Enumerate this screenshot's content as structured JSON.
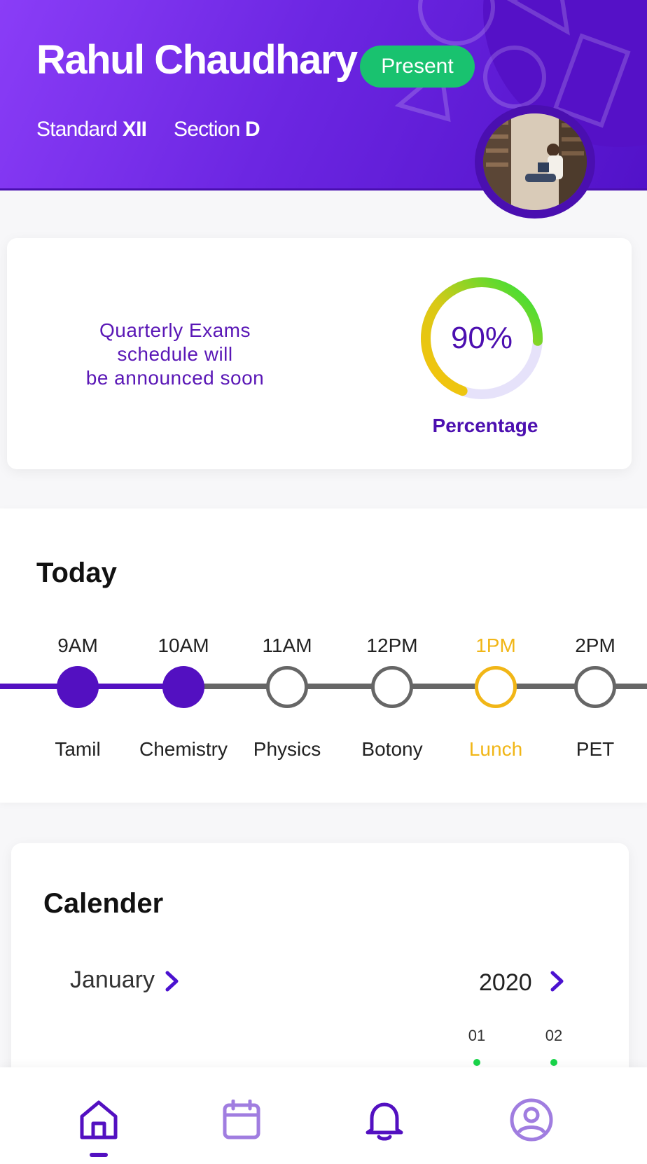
{
  "header": {
    "name": "Rahul Chaudhary",
    "status": "Present",
    "standard_label": "Standard",
    "standard_value": "XII",
    "section_label": "Section",
    "section_value": "D"
  },
  "summary": {
    "notice_line1": "Quarterly Exams",
    "notice_line2": "schedule will",
    "notice_line3": "be announced soon",
    "percentage_value": "90%",
    "percentage_fraction": 0.9,
    "percentage_label": "Percentage"
  },
  "today": {
    "title": "Today",
    "slots": [
      {
        "time": "9AM",
        "subject": "Tamil",
        "state": "done"
      },
      {
        "time": "10AM",
        "subject": "Chemistry",
        "state": "done"
      },
      {
        "time": "11AM",
        "subject": "Physics",
        "state": "todo"
      },
      {
        "time": "12PM",
        "subject": "Botony",
        "state": "todo"
      },
      {
        "time": "1PM",
        "subject": "Lunch",
        "state": "highlight"
      },
      {
        "time": "2PM",
        "subject": "PET",
        "state": "todo"
      }
    ]
  },
  "calendar": {
    "title": "Calender",
    "month": "January",
    "year": "2020",
    "days": [
      "01",
      "02"
    ]
  },
  "colors": {
    "primary": "#5310c1",
    "present_green": "#19c26f",
    "highlight": "#f1b617"
  },
  "nav": {
    "items": [
      "home-icon",
      "calendar-icon",
      "bell-icon",
      "profile-icon"
    ],
    "active": "home-icon"
  }
}
